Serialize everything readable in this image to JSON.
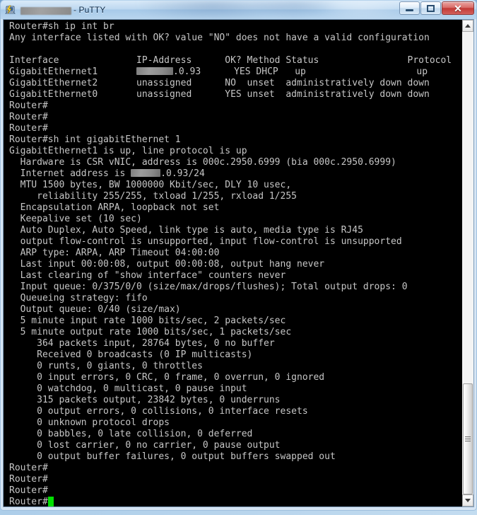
{
  "window": {
    "title_redacted_host": "[REDACTED]",
    "title_suffix": "- PuTTY",
    "icon": "putty-terminal-icon",
    "controls": {
      "minimize": "Minimize",
      "maximize": "Restore",
      "close": "Close",
      "close_glyph": "✕"
    }
  },
  "scrollbar": {
    "up_label": "Scroll up",
    "down_label": "Scroll down",
    "thumb_label": "Scroll thumb",
    "position_percent": 88
  },
  "terminal": {
    "foreground_color": "#c6c6c6",
    "background_color": "#000000",
    "cursor_color": "#00e000",
    "prompt": "Router#",
    "lines": [
      {
        "id": "l01",
        "text": "Router#sh ip int br"
      },
      {
        "id": "l02",
        "text": "Any interface listed with OK? value \"NO\" does not have a valid configuration"
      },
      {
        "id": "l03",
        "text": ""
      },
      {
        "id": "l04",
        "text": "Interface              IP-Address      OK? Method Status                Protocol"
      },
      {
        "id": "l05",
        "pre": "GigabitEthernet1       ",
        "redact": "wide",
        "post": ".0.93      YES DHCP   up                    up"
      },
      {
        "id": "l06",
        "text": "GigabitEthernet2       unassigned      NO  unset  administratively down down"
      },
      {
        "id": "l07",
        "text": "GigabitEthernet0       unassigned      YES unset  administratively down down"
      },
      {
        "id": "l08",
        "text": "Router#"
      },
      {
        "id": "l09",
        "text": "Router#"
      },
      {
        "id": "l10",
        "text": "Router#"
      },
      {
        "id": "l11",
        "text": "Router#sh int gigabitEthernet 1"
      },
      {
        "id": "l12",
        "text": "GigabitEthernet1 is up, line protocol is up"
      },
      {
        "id": "l13",
        "text": "  Hardware is CSR vNIC, address is 000c.2950.6999 (bia 000c.2950.6999)"
      },
      {
        "id": "l14",
        "pre": "  Internet address is ",
        "redact": "short",
        "post": ".0.93/24"
      },
      {
        "id": "l15",
        "text": "  MTU 1500 bytes, BW 1000000 Kbit/sec, DLY 10 usec,"
      },
      {
        "id": "l16",
        "text": "     reliability 255/255, txload 1/255, rxload 1/255"
      },
      {
        "id": "l17",
        "text": "  Encapsulation ARPA, loopback not set"
      },
      {
        "id": "l18",
        "text": "  Keepalive set (10 sec)"
      },
      {
        "id": "l19",
        "text": "  Auto Duplex, Auto Speed, link type is auto, media type is RJ45"
      },
      {
        "id": "l20",
        "text": "  output flow-control is unsupported, input flow-control is unsupported"
      },
      {
        "id": "l21",
        "text": "  ARP type: ARPA, ARP Timeout 04:00:00"
      },
      {
        "id": "l22",
        "text": "  Last input 00:00:08, output 00:00:08, output hang never"
      },
      {
        "id": "l23",
        "text": "  Last clearing of \"show interface\" counters never"
      },
      {
        "id": "l24",
        "text": "  Input queue: 0/375/0/0 (size/max/drops/flushes); Total output drops: 0"
      },
      {
        "id": "l25",
        "text": "  Queueing strategy: fifo"
      },
      {
        "id": "l26",
        "text": "  Output queue: 0/40 (size/max)"
      },
      {
        "id": "l27",
        "text": "  5 minute input rate 1000 bits/sec, 2 packets/sec"
      },
      {
        "id": "l28",
        "text": "  5 minute output rate 1000 bits/sec, 1 packets/sec"
      },
      {
        "id": "l29",
        "text": "     364 packets input, 28764 bytes, 0 no buffer"
      },
      {
        "id": "l30",
        "text": "     Received 0 broadcasts (0 IP multicasts)"
      },
      {
        "id": "l31",
        "text": "     0 runts, 0 giants, 0 throttles"
      },
      {
        "id": "l32",
        "text": "     0 input errors, 0 CRC, 0 frame, 0 overrun, 0 ignored"
      },
      {
        "id": "l33",
        "text": "     0 watchdog, 0 multicast, 0 pause input"
      },
      {
        "id": "l34",
        "text": "     315 packets output, 23842 bytes, 0 underruns"
      },
      {
        "id": "l35",
        "text": "     0 output errors, 0 collisions, 0 interface resets"
      },
      {
        "id": "l36",
        "text": "     0 unknown protocol drops"
      },
      {
        "id": "l37",
        "text": "     0 babbles, 0 late collision, 0 deferred"
      },
      {
        "id": "l38",
        "text": "     0 lost carrier, 0 no carrier, 0 pause output"
      },
      {
        "id": "l39",
        "text": "     0 output buffer failures, 0 output buffers swapped out"
      },
      {
        "id": "l40",
        "text": "Router#"
      },
      {
        "id": "l41",
        "text": "Router#"
      },
      {
        "id": "l42",
        "text": "Router#"
      },
      {
        "id": "l43",
        "text": "Router#",
        "cursor": true
      }
    ]
  }
}
